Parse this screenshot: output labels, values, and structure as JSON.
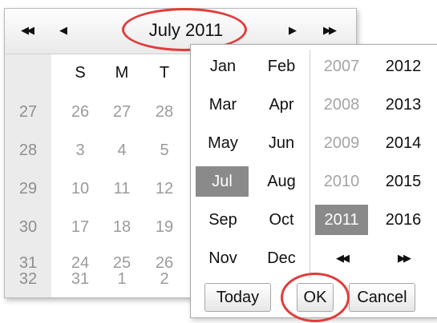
{
  "calendar": {
    "title": "July 2011",
    "nav": {
      "prev_year_icon": "◀◀",
      "prev_month_icon": "◀",
      "next_month_icon": "▶",
      "next_year_icon": "▶▶"
    },
    "weekday_headers": [
      "S",
      "M",
      "T"
    ],
    "weeks": [
      {
        "num": "27",
        "days": [
          "26",
          "27",
          "28"
        ]
      },
      {
        "num": "28",
        "days": [
          "3",
          "4",
          "5"
        ]
      },
      {
        "num": "29",
        "days": [
          "10",
          "11",
          "12"
        ]
      },
      {
        "num": "30",
        "days": [
          "17",
          "18",
          "19"
        ]
      },
      {
        "num": "31",
        "days": [
          "24",
          "25",
          "26"
        ]
      },
      {
        "num": "32",
        "days": [
          "31",
          "1",
          "2"
        ]
      }
    ]
  },
  "picker": {
    "months": [
      [
        "Jan",
        "Feb"
      ],
      [
        "Mar",
        "Apr"
      ],
      [
        "May",
        "Jun"
      ],
      [
        "Jul",
        "Aug"
      ],
      [
        "Sep",
        "Oct"
      ],
      [
        "Nov",
        "Dec"
      ]
    ],
    "selected_month": "Jul",
    "years": [
      [
        "2007",
        "2012"
      ],
      [
        "2008",
        "2013"
      ],
      [
        "2009",
        "2014"
      ],
      [
        "2010",
        "2015"
      ],
      [
        "2011",
        "2016"
      ]
    ],
    "selected_year": "2011",
    "year_nav": {
      "prev_icon": "◀◀",
      "next_icon": "▶▶"
    },
    "buttons": {
      "today": "Today",
      "ok": "OK",
      "cancel": "Cancel"
    }
  },
  "colors": {
    "annotation_ring": "#e33b3b",
    "selected_bg": "#8a8a8a"
  }
}
